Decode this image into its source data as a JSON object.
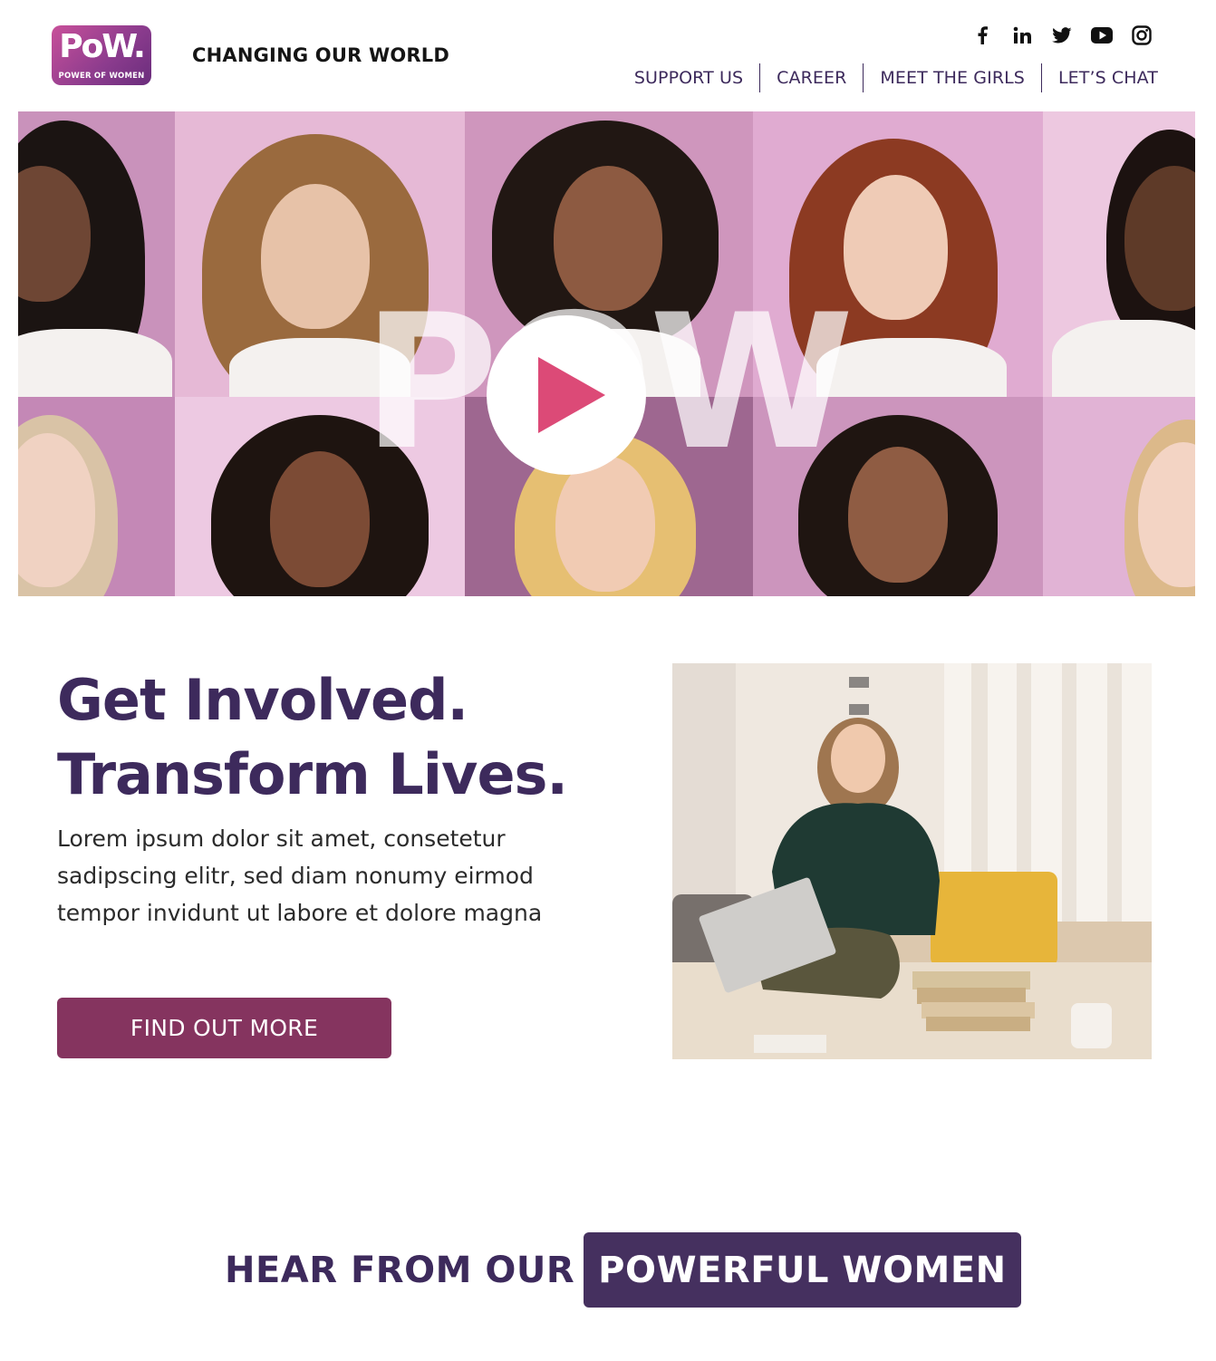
{
  "brand": {
    "logo_mark": "PoW.",
    "logo_sub": "POWER OF WOMEN",
    "tagline": "CHANGING OUR WORLD",
    "accent_color": "#3d2a5c",
    "cta_color": "#85345f",
    "play_color": "#dc4a77"
  },
  "social": [
    "facebook-icon",
    "linkedin-icon",
    "twitter-icon",
    "youtube-icon",
    "instagram-icon"
  ],
  "nav": {
    "items": [
      {
        "label": "SUPPORT US"
      },
      {
        "label": "CAREER"
      },
      {
        "label": "MEET THE GIRLS"
      },
      {
        "label": "LET’S CHAT"
      }
    ]
  },
  "hero": {
    "overlay_word": "POW"
  },
  "main": {
    "headline_line1": "Get Involved.",
    "headline_line2": "Transform Lives.",
    "body_line1": "Lorem ipsum dolor sit amet, consetetur",
    "body_line2": "sadipscing elitr, sed diam nonumy eirmod",
    "body_line3": "tempor invidunt ut labore et dolore magna",
    "cta_label": "FIND OUT MORE"
  },
  "testimonials": {
    "heading_plain": "HEAR FROM OUR",
    "heading_highlight": "POWERFUL WOMEN"
  }
}
